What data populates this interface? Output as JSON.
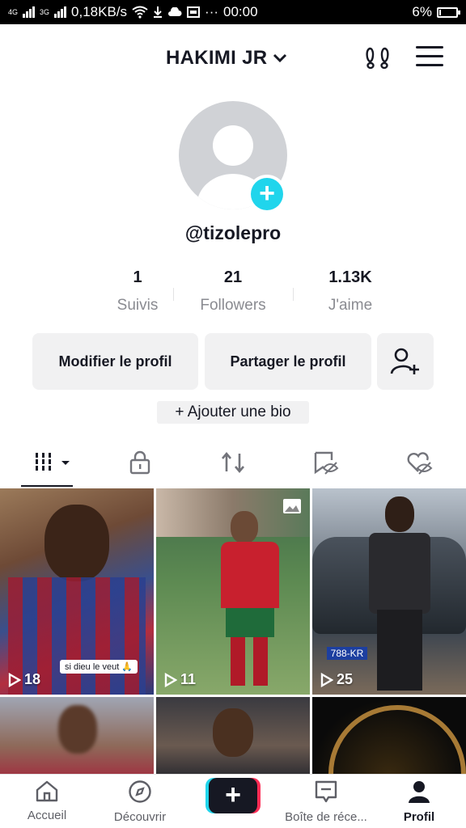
{
  "status_bar": {
    "network_1": "4G",
    "network_2": "3G",
    "speed": "0,18KB/s",
    "time": "00:00",
    "battery": "6%"
  },
  "header": {
    "title": "HAKIMI JR"
  },
  "profile": {
    "username": "@tizolepro"
  },
  "stats": [
    {
      "value": "1",
      "label": "Suivis"
    },
    {
      "value": "21",
      "label": "Followers"
    },
    {
      "value": "1.13K",
      "label": "J'aime"
    }
  ],
  "buttons": {
    "edit_profile": "Modifier le profil",
    "share_profile": "Partager le profil",
    "add_bio": "+ Ajouter une bio"
  },
  "grid": [
    {
      "plays": "18",
      "caption": "si dieu le veut 🙏"
    },
    {
      "plays": "11"
    },
    {
      "plays": "25"
    }
  ],
  "bottom_nav": {
    "home": "Accueil",
    "discover": "Découvrir",
    "inbox": "Boîte de réce...",
    "profile": "Profil"
  }
}
